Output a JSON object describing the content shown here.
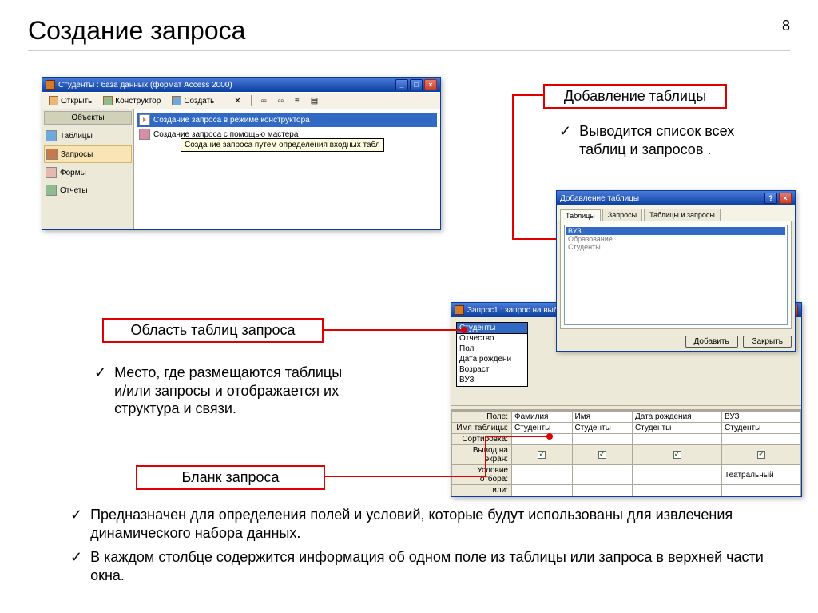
{
  "page": {
    "title": "Создание запроса",
    "num": "8"
  },
  "dbwin": {
    "title": "Студенты : база данных (формат Access 2000)",
    "tb_open": "Открыть",
    "tb_design": "Конструктор",
    "tb_create": "Создать",
    "side_header": "Объекты",
    "side_tables": "Таблицы",
    "side_queries": "Запросы",
    "side_forms": "Формы",
    "side_reports": "Отчеты",
    "item1": "Создание запроса в режиме конструктора",
    "item2": "Создание запроса с помощью мастера",
    "tooltip": "Создание запроса путем определения входных табл"
  },
  "callout_addtbl": "Добавление таблицы",
  "addtbl_text": "Выводится список всех таблиц и запросов .",
  "addwin": {
    "title": "Добавление таблицы",
    "tab1": "Таблицы",
    "tab2": "Запросы",
    "tab3": "Таблицы и запросы",
    "list": [
      "ВУЗ",
      "Образование",
      "Студенты"
    ],
    "btn_add": "Добавить",
    "btn_close": "Закрыть"
  },
  "qwin": {
    "title": "Запрос1 : запрос на выборку",
    "tbl_name": "Студенты",
    "fields": [
      "Отчество",
      "Пол",
      "Дата рождени",
      "Возраст",
      "ВУЗ"
    ],
    "row_field": "Поле:",
    "row_table": "Имя таблицы:",
    "row_sort": "Сортировка:",
    "row_show": "Вывод на экран:",
    "row_cond": "Условие отбора:",
    "row_or": "или:",
    "cols": [
      {
        "field": "Фамилия",
        "table": "Студенты",
        "show": true,
        "cond": ""
      },
      {
        "field": "Имя",
        "table": "Студенты",
        "show": true,
        "cond": ""
      },
      {
        "field": "Дата рождения",
        "table": "Студенты",
        "show": true,
        "cond": ""
      },
      {
        "field": "ВУЗ",
        "table": "Студенты",
        "show": true,
        "cond": "Театральный"
      }
    ]
  },
  "callout_area": "Область таблиц запроса",
  "area_text": "Место, где размещаются таблицы и/или запросы и отображается их структура и связи.",
  "callout_blank": "Бланк запроса",
  "blank_text1": "Предназначен для определения полей и условий, которые будут использованы для извлечения динамического набора данных.",
  "blank_text2": "В каждом столбце содержится информация об одном поле из таблицы или запроса в верхней части окна."
}
